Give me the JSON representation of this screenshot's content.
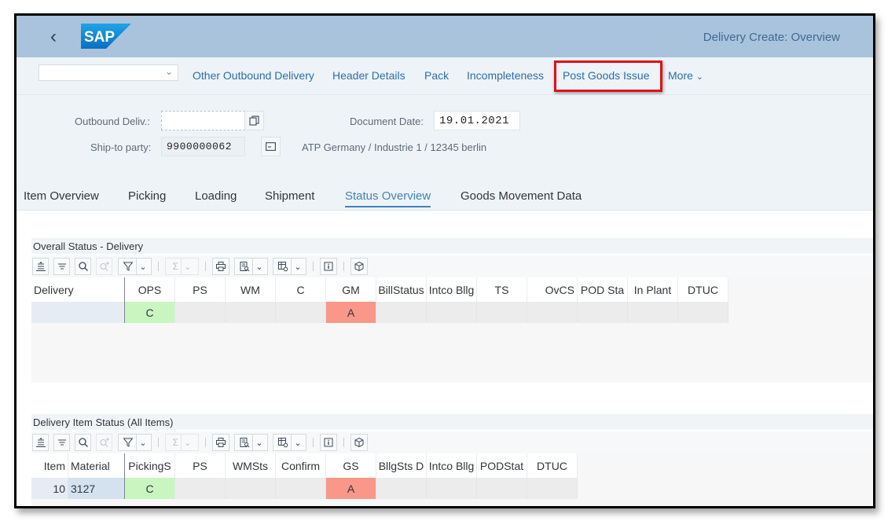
{
  "shell": {
    "back_icon": "chevron-left-icon",
    "logo_text": "SAP",
    "title": "Delivery  Create: Overview"
  },
  "toolbar": {
    "select_value": "",
    "buttons": [
      {
        "label": "Other Outbound Delivery"
      },
      {
        "label": "Header Details"
      },
      {
        "label": "Pack"
      },
      {
        "label": "Incompleteness"
      },
      {
        "label": "Post Goods Issue",
        "highlighted": true
      },
      {
        "label": "More"
      }
    ],
    "highlight_color": "#e0111a"
  },
  "header": {
    "outbound_deliv_label": "Outbound Deliv.:",
    "outbound_deliv_value": "",
    "document_date_label": "Document Date:",
    "document_date_value": "19.01.2021",
    "ship_to_label": "Ship-to party:",
    "ship_to_value": "9900000062",
    "ship_to_address": "ATP Germany / Industrie 1 / 12345 berlin"
  },
  "tabs": [
    {
      "label": "Item Overview",
      "active": false
    },
    {
      "label": "Picking",
      "active": false
    },
    {
      "label": "Loading",
      "active": false
    },
    {
      "label": "Shipment",
      "active": false
    },
    {
      "label": "Status Overview",
      "active": true
    },
    {
      "label": "Goods Movement Data",
      "active": false
    }
  ],
  "overall_status": {
    "title": "Overall Status - Delivery",
    "columns": [
      "Delivery",
      "OPS",
      "PS",
      "WM",
      "C",
      "GM",
      "BillStatus",
      "Intco Bllg",
      "TS",
      "OvCS",
      "POD Sta",
      "In Plant",
      "DTUC"
    ],
    "rows": [
      [
        "",
        "C",
        "",
        "",
        "",
        "A",
        "",
        "",
        "",
        "",
        "",
        "",
        ""
      ]
    ]
  },
  "item_status": {
    "title": "Delivery Item Status (All Items)",
    "columns": [
      "Item",
      "Material",
      "PickingS",
      "PS",
      "WMSts",
      "Confirm",
      "GS",
      "BllgSts D",
      "Intco Bllg",
      "PODStat",
      "DTUC"
    ],
    "rows": [
      [
        "10",
        "3127",
        "C",
        "",
        "",
        "",
        "A",
        "",
        "",
        "",
        ""
      ]
    ]
  },
  "status_colors": {
    "complete": "#c9f5c0",
    "not_processed": "#f8978a",
    "accent": "#3f83bf"
  }
}
